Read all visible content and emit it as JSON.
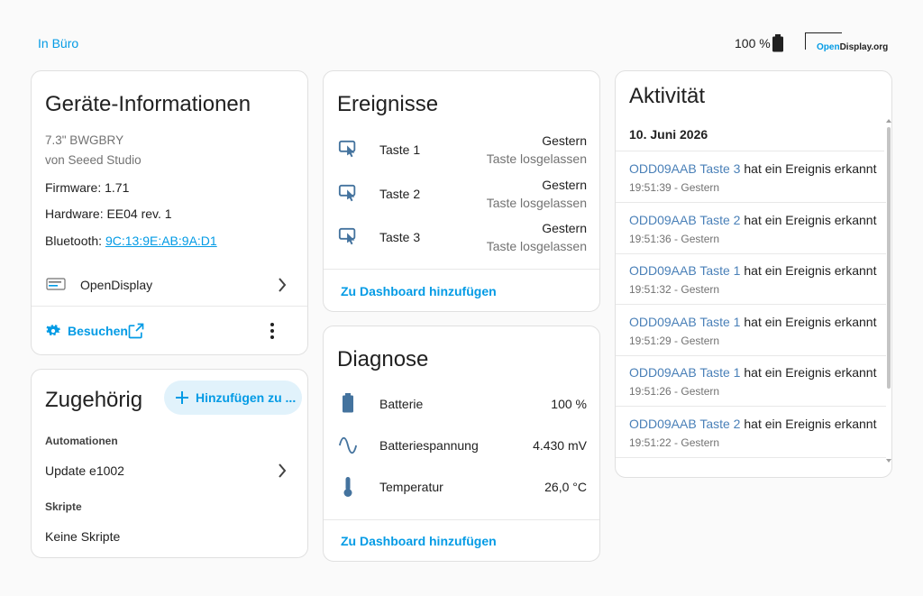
{
  "header": {
    "area": "In Büro",
    "battery": "100 %",
    "brand": {
      "open": "Open",
      "display": "Display.org"
    }
  },
  "device_info": {
    "title": "Geräte-Informationen",
    "model": "7.3\" BWGBRY",
    "manufacturer": "von Seeed Studio",
    "firmware": "Firmware: 1.71",
    "hardware": "Hardware: EE04 rev. 1",
    "bluetooth_label": "Bluetooth:",
    "bluetooth_value": "9C:13:9E:AB:9A:D1",
    "integration": "OpenDisplay",
    "visit": "Besuchen"
  },
  "related": {
    "title": "Zugehörig",
    "add_button": "Hinzufügen zu ...",
    "automations_label": "Automationen",
    "automation_item": "Update e1002",
    "scripts_label": "Skripte",
    "scripts_empty": "Keine Skripte"
  },
  "events": {
    "title": "Ereignisse",
    "items": [
      {
        "name": "Taste 1",
        "when": "Gestern",
        "state": "Taste losgelassen"
      },
      {
        "name": "Taste 2",
        "when": "Gestern",
        "state": "Taste losgelassen"
      },
      {
        "name": "Taste 3",
        "when": "Gestern",
        "state": "Taste losgelassen"
      }
    ],
    "add_dashboard": "Zu Dashboard hinzufügen"
  },
  "diagnostics": {
    "title": "Diagnose",
    "items": [
      {
        "name": "Batterie",
        "value": "100 %"
      },
      {
        "name": "Batteriespannung",
        "value": "4.430 mV"
      },
      {
        "name": "Temperatur",
        "value": "26,0 °C"
      }
    ],
    "add_dashboard": "Zu Dashboard hinzufügen"
  },
  "activity": {
    "title": "Aktivität",
    "date": "10. Juni 2026",
    "items": [
      {
        "entity": "ODD09AAB Taste 3",
        "text": " hat ein Ereignis erkannt",
        "time": "19:51:39 - Gestern"
      },
      {
        "entity": "ODD09AAB Taste 2",
        "text": " hat ein Ereignis erkannt",
        "time": "19:51:36 - Gestern"
      },
      {
        "entity": "ODD09AAB Taste 1",
        "text": " hat ein Ereignis erkannt",
        "time": "19:51:32 - Gestern"
      },
      {
        "entity": "ODD09AAB Taste 1",
        "text": " hat ein Ereignis erkannt",
        "time": "19:51:29 - Gestern"
      },
      {
        "entity": "ODD09AAB Taste 1",
        "text": " hat ein Ereignis erkannt",
        "time": "19:51:26 - Gestern"
      },
      {
        "entity": "ODD09AAB Taste 2",
        "text": " hat ein Ereignis erkannt",
        "time": "19:51:22 - Gestern"
      }
    ]
  },
  "colors": {
    "accent": "#039be5",
    "entity_link": "#4a80b8",
    "icon": "#44739e",
    "border": "#e0e0e0"
  }
}
